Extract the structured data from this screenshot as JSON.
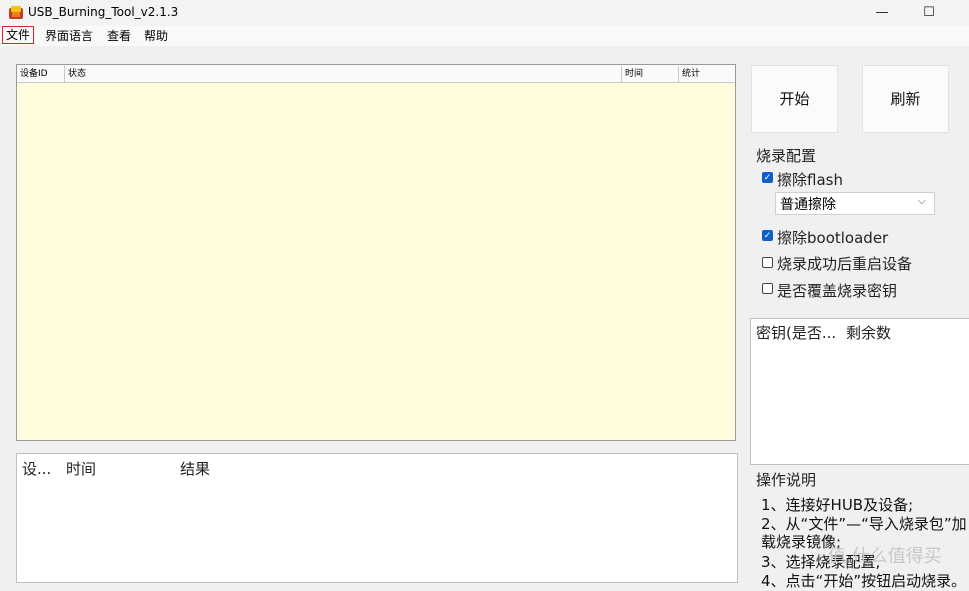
{
  "window": {
    "title": "USB_Burning_Tool_v2.1.3",
    "minimize_glyph": "—",
    "maximize_glyph": "☐"
  },
  "menu": {
    "file": "文件",
    "language": "界面语言",
    "view": "查看",
    "help": "帮助"
  },
  "device_table": {
    "columns": [
      "设备ID",
      "状态",
      "时间",
      "统计"
    ]
  },
  "log_table": {
    "columns": [
      "设...",
      "时间",
      "结果"
    ]
  },
  "buttons": {
    "start": "开始",
    "refresh": "刷新"
  },
  "config": {
    "section_title": "烧录配置",
    "erase_flash": {
      "label": "擦除flash",
      "checked": true
    },
    "erase_mode": "普通擦除",
    "erase_bootloader": {
      "label": "擦除bootloader",
      "checked": true
    },
    "reboot_after": {
      "label": "烧录成功后重启设备",
      "checked": false
    },
    "overwrite_key": {
      "label": "是否覆盖烧录密钥",
      "checked": false
    }
  },
  "key_table": {
    "columns": [
      "密钥(是否...",
      "剩余数"
    ]
  },
  "instructions": {
    "title": "操作说明",
    "lines": [
      "1、连接好HUB及设备;",
      "2、从“文件”—“导入烧录包”加",
      "载烧录镜像;",
      "3、选择烧录配置,",
      "4、点击“开始”按钮启动烧录。"
    ]
  },
  "watermark": "值 什么值得买",
  "colors": {
    "device_table_bg": "#fefcdc",
    "checkbox_checked": "#0f5fc7",
    "file_menu_highlight": "#e0242c"
  }
}
